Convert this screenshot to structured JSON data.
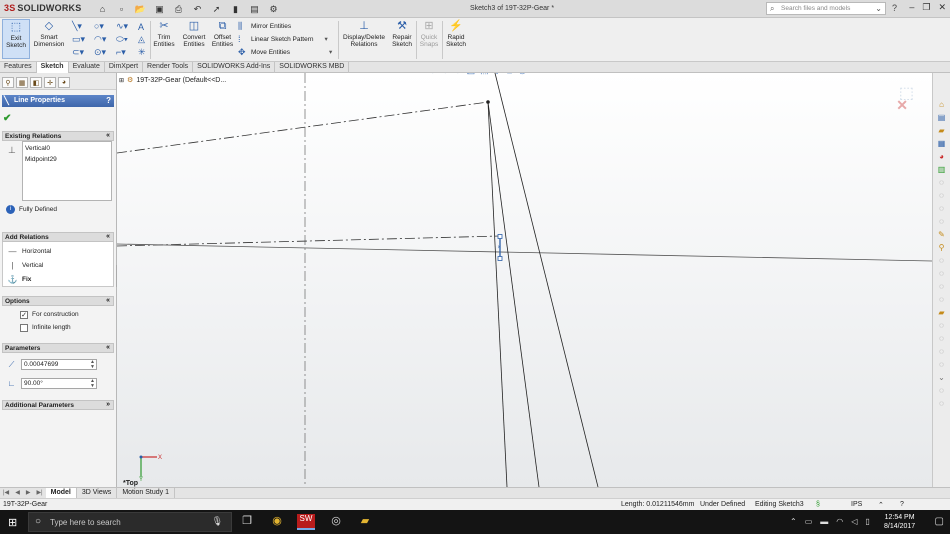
{
  "app": {
    "logo_ds": "3S",
    "logo_text": "SOLIDWORKS",
    "document_title": "Sketch3 of 19T-32P-Gear *",
    "search_placeholder": "Search files and models",
    "help_icon": "question-icon"
  },
  "ribbon": {
    "exit_sketch": "Exit\nSketch",
    "smart_dimension": "Smart\nDimension",
    "trim_entities": "Trim\nEntities",
    "convert_entities": "Convert\nEntities",
    "offset_entities": "Offset\nEntities",
    "mirror_entities": "Mirror Entities",
    "linear_sketch_pattern": "Linear Sketch Pattern",
    "move_entities": "Move Entities",
    "display_delete_relations": "Display/Delete\nRelations",
    "repair_sketch": "Repair\nSketch",
    "quick_snaps": "Quick\nSnaps",
    "rapid_sketch": "Rapid\nSketch"
  },
  "command_tabs": [
    "Features",
    "Sketch",
    "Evaluate",
    "DimXpert",
    "Render Tools",
    "SOLIDWORKS Add-Ins",
    "SOLIDWORKS MBD"
  ],
  "active_command_tab": "Sketch",
  "property_manager": {
    "title": "Line Properties",
    "existing_relations": {
      "label": "Existing Relations",
      "items": [
        "Vertical0",
        "Midpoint29"
      ],
      "status": "Fully Defined"
    },
    "add_relations": {
      "label": "Add Relations",
      "items": [
        "Horizontal",
        "Vertical",
        "Fix"
      ]
    },
    "options": {
      "label": "Options",
      "for_construction": "For construction",
      "for_construction_checked": true,
      "infinite_length": "Infinite length",
      "infinite_length_checked": false
    },
    "parameters": {
      "label": "Parameters",
      "length": "0.00047699",
      "angle": "90.00°"
    },
    "additional_parameters": {
      "label": "Additional Parameters"
    }
  },
  "graphics": {
    "tree_node": "19T-32P-Gear  (Default<<D...",
    "view_label": "*Top",
    "triad_x": "X",
    "triad_y": "Y"
  },
  "model_tabs": [
    "Model",
    "3D Views",
    "Motion Study 1"
  ],
  "active_model_tab": "Model",
  "statusbar": {
    "part_name": "19T-32P-Gear",
    "length": "Length: 0.01211546mm",
    "definition": "Under Defined",
    "editing": "Editing Sketch3",
    "units": "IPS"
  },
  "taskbar": {
    "search_placeholder": "Type here to search",
    "time": "12:54 PM",
    "date": "8/14/2017"
  }
}
